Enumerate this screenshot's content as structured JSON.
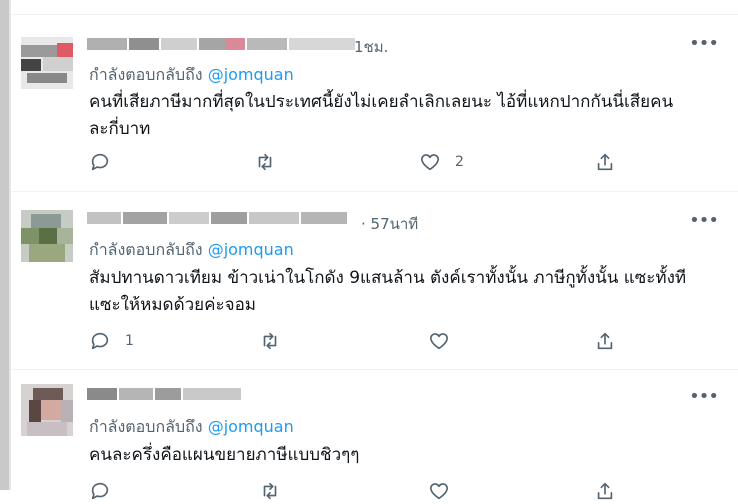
{
  "tweets": [
    {
      "time": "1ชม.",
      "replying_label": "กำลังตอบกลับถึง",
      "replying_handle": "@jomquan",
      "text_lines": [
        "คนที่เสียภาษีมากที่สุดในประเทศนี้ยังไม่เคยลำเลิกเลยนะ ไอ้ที่แหกปากกันนี่เสียคน",
        "ละกี่บาท"
      ],
      "reply_count": "",
      "retweet_count": "",
      "like_count": "2"
    },
    {
      "time": "· 57นาที",
      "replying_label": "กำลังตอบกลับถึง",
      "replying_handle": "@jomquan",
      "text_lines": [
        "สัมปทานดาวเทียม ข้าวเน่าในโกดัง 9แสนล้าน ตังค์เราทั้งนั้น ภาษีกูทั้งนั้น  แซะทั้งที",
        "แซะให้หมดด้วยค่ะจอม"
      ],
      "reply_count": "1",
      "retweet_count": "",
      "like_count": ""
    },
    {
      "time": "",
      "replying_label": "กำลังตอบกลับถึง",
      "replying_handle": "@jomquan",
      "text_lines": [
        "คนละครึ่งคือแผนขยายภาษีแบบชิวๆๆ"
      ],
      "reply_count": "",
      "retweet_count": "",
      "like_count": ""
    }
  ],
  "more_label": "•••",
  "icons": {
    "reply": "reply-icon",
    "retweet": "retweet-icon",
    "like": "heart-icon",
    "share": "share-icon",
    "more": "more-options-icon"
  },
  "colors": {
    "link": "#1d9bf0",
    "muted": "#536471",
    "text": "#0f1419"
  }
}
